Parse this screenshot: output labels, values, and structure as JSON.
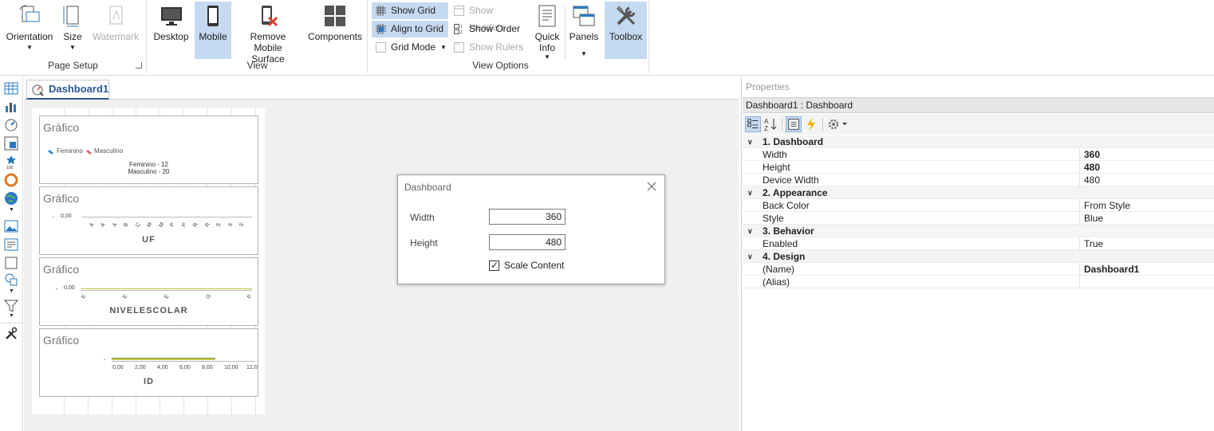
{
  "ribbon": {
    "page_setup": {
      "label": "Page Setup",
      "orientation": "Orientation",
      "size": "Size",
      "watermark": "Watermark"
    },
    "view": {
      "label": "View",
      "desktop": "Desktop",
      "mobile": "Mobile",
      "remove_mobile_line1": "Remove Mobile",
      "remove_mobile_line2": "Surface",
      "components": "Components"
    },
    "view_options": {
      "label": "View Options",
      "show_grid": "Show Grid",
      "align_to_grid": "Align to Grid",
      "grid_mode": "Grid Mode",
      "show_headers": "Show Headers",
      "show_order": "Show Order",
      "show_rulers": "Show Rulers",
      "quick_info_line1": "Quick",
      "quick_info_line2": "Info",
      "panels": "Panels",
      "toolbox": "Toolbox"
    }
  },
  "document_tab": {
    "label": "Dashboard1"
  },
  "panels": [
    {
      "title": "Gráfico",
      "legend": [
        "Feminino",
        "Masculino"
      ],
      "labels": [
        "Feminino - 12",
        "Masculino - 20"
      ]
    },
    {
      "title": "Gráfico",
      "axis_value": "0,00",
      "ticks": [
        "A",
        "A",
        "A",
        "B",
        "C",
        "M",
        "M",
        "P",
        "P",
        "R",
        "R",
        "S",
        "S",
        "S"
      ],
      "axis_title": "UF"
    },
    {
      "title": "Gráfico",
      "axis_value": "0,00",
      "ticks": [
        "E",
        "E",
        "E",
        "G",
        "P"
      ],
      "axis_title": "NIVELESCOLAR"
    },
    {
      "title": "Gráfico",
      "ticks": [
        "0,00",
        "2,00",
        "4,00",
        "6,00",
        "8,00",
        "10,00",
        "12,0"
      ],
      "axis_title": "ID"
    }
  ],
  "dialog": {
    "title": "Dashboard",
    "width_label": "Width",
    "width_value": "360",
    "height_label": "Height",
    "height_value": "480",
    "scale_label": "Scale Content",
    "scale_checked": "✓"
  },
  "properties": {
    "title": "Properties",
    "object": "Dashboard1 : Dashboard",
    "categories": [
      {
        "name": "1. Dashboard",
        "rows": [
          {
            "name": "Width",
            "value": "360",
            "bold": true
          },
          {
            "name": "Height",
            "value": "480",
            "bold": true
          },
          {
            "name": "Device Width",
            "value": "480",
            "bold": false
          }
        ]
      },
      {
        "name": "2. Appearance",
        "rows": [
          {
            "name": "Back Color",
            "value": "From Style",
            "bold": false
          },
          {
            "name": "Style",
            "value": "Blue",
            "bold": false
          }
        ]
      },
      {
        "name": "3. Behavior",
        "rows": [
          {
            "name": "Enabled",
            "value": "True",
            "bold": false
          }
        ]
      },
      {
        "name": "4. Design",
        "rows": [
          {
            "name": "(Name)",
            "value": "Dashboard1",
            "bold": true
          },
          {
            "name": "(Alias)",
            "value": "",
            "bold": false
          }
        ]
      }
    ]
  },
  "colors": {
    "accent": "#2b579a",
    "active_bg": "#c5d9f1",
    "female": "#3a8fd6",
    "male": "#e06c6c",
    "series_line": "#c9c24a"
  }
}
